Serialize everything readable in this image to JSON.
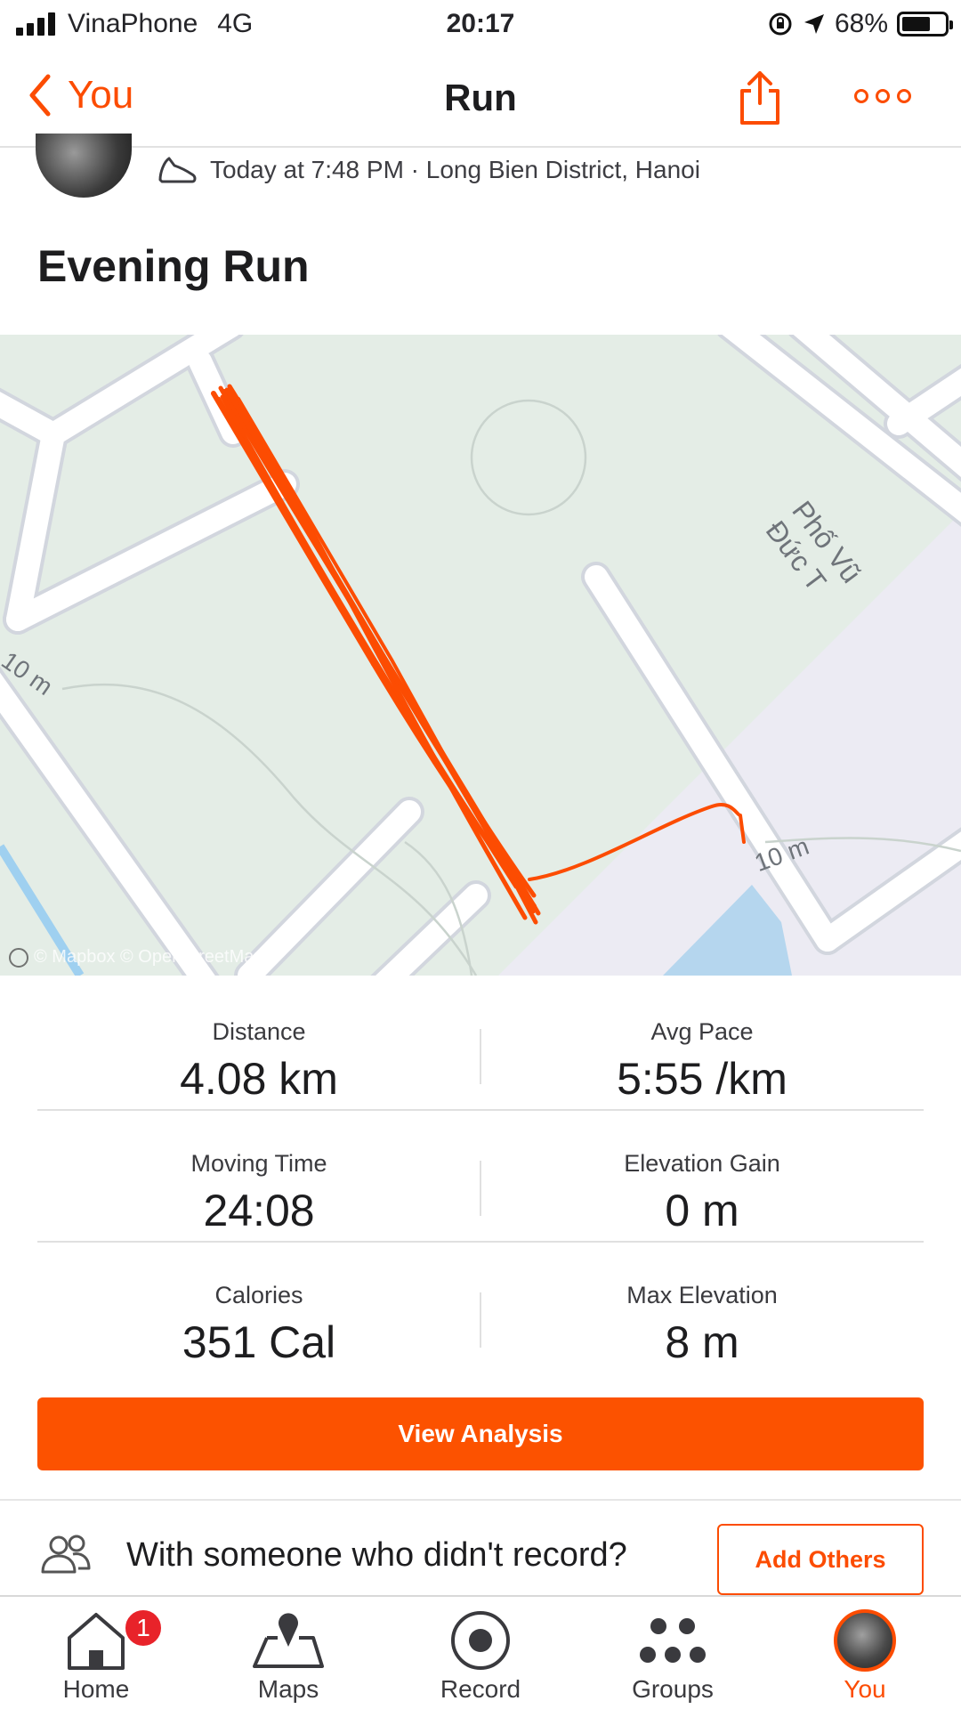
{
  "status_bar": {
    "carrier": "VinaPhone",
    "network": "4G",
    "time": "20:17",
    "battery": "68%",
    "battery_level": 0.68
  },
  "nav": {
    "back_label": "You",
    "title": "Run"
  },
  "activity": {
    "meta": "Today at 7:48 PM · Long Bien District, Hanoi",
    "title": "Evening Run"
  },
  "map": {
    "street_label": "Phố Vũ Đức T",
    "contour_label_1": "10 m",
    "contour_label_2": "10 m",
    "attribution": "© Mapbox © OpenStreetMap",
    "route_color": "#fc4c02"
  },
  "stats": [
    {
      "left_label": "Distance",
      "left_value": "4.08 km",
      "right_label": "Avg Pace",
      "right_value": "5:55 /km"
    },
    {
      "left_label": "Moving Time",
      "left_value": "24:08",
      "right_label": "Elevation Gain",
      "right_value": "0 m"
    },
    {
      "left_label": "Calories",
      "left_value": "351 Cal",
      "right_label": "Max Elevation",
      "right_value": "8 m"
    }
  ],
  "actions": {
    "view_analysis": "View Analysis",
    "with_someone": "With someone who didn't record?",
    "add_others": "Add Others"
  },
  "tabs": [
    {
      "label": "Home",
      "icon": "home-icon",
      "badge": "1"
    },
    {
      "label": "Maps",
      "icon": "maps-icon"
    },
    {
      "label": "Record",
      "icon": "record-icon"
    },
    {
      "label": "Groups",
      "icon": "groups-icon"
    },
    {
      "label": "You",
      "icon": "avatar",
      "active": true
    }
  ],
  "colors": {
    "accent": "#fc4c02",
    "button": "#fc5200",
    "badge": "#e8232a"
  }
}
